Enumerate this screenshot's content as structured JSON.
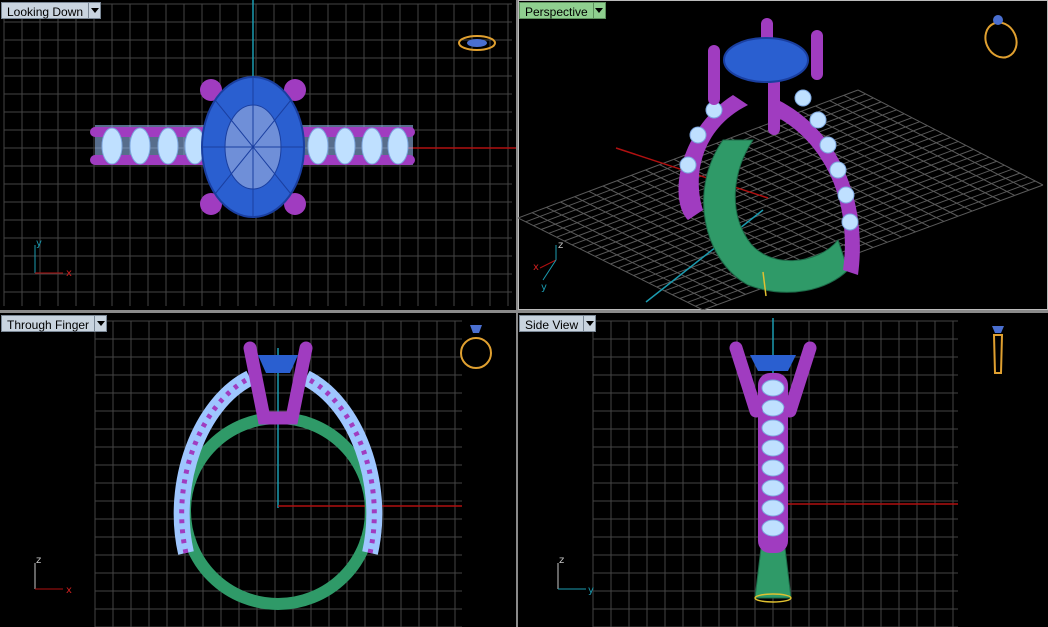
{
  "viewports": {
    "top": {
      "title": "Looking Down",
      "axis_h": "x",
      "axis_v": "y"
    },
    "perspective": {
      "title": "Perspective",
      "axis_h": "x",
      "axis_v": "z",
      "axis_d": "y"
    },
    "front": {
      "title": "Through Finger",
      "axis_h": "x",
      "axis_v": "z"
    },
    "side": {
      "title": "Side View",
      "axis_h": "y",
      "axis_v": "z"
    }
  },
  "colors": {
    "background": "#000000",
    "grid": "#4a4a4a",
    "grid_major": "#7a7a7a",
    "x_axis": "#b01010",
    "y_axis": "#1b9bb0",
    "gem": "#2a5fd0",
    "prong": "#a03cc0",
    "accent_stone": "#9ec6ff",
    "shank": "#2f9a68",
    "nav_cube": "#e0a030",
    "active_label": "#8fcf8f",
    "label": "#c9d4df"
  },
  "icons": [
    "view-cube-top-icon",
    "view-cube-perspective-icon",
    "view-cube-front-icon",
    "view-cube-side-icon",
    "viewport-menu-arrow-icon"
  ]
}
